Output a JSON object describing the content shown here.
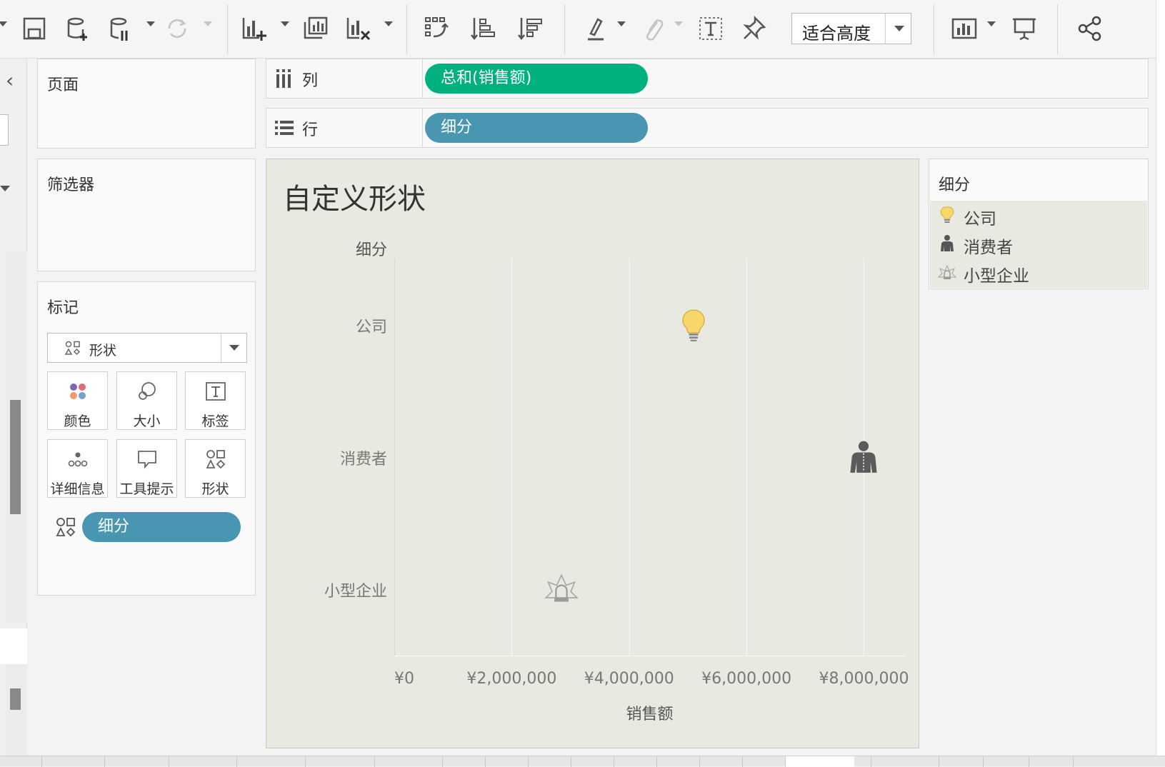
{
  "toolbar": {
    "fit_select_value": "适合高度",
    "icons": [
      "save-icon",
      "new-datasource-icon",
      "pause-update-icon",
      "refresh-icon",
      "new-worksheet-icon",
      "duplicate-sheet-icon",
      "clear-sheet-icon",
      "swap-icon",
      "sort-ascending-icon",
      "sort-descending-icon",
      "highlight-icon",
      "attach-icon",
      "text-label-icon",
      "pin-icon",
      "show-me-icon",
      "presentation-icon",
      "share-icon"
    ]
  },
  "pages_panel": {
    "title": "页面"
  },
  "filters_panel": {
    "title": "筛选器"
  },
  "marks_panel": {
    "title": "标记",
    "mark_type": "形状",
    "buttons": [
      {
        "label": "颜色",
        "icon": "color-icon"
      },
      {
        "label": "大小",
        "icon": "size-icon"
      },
      {
        "label": "标签",
        "icon": "label-icon"
      },
      {
        "label": "详细信息",
        "icon": "detail-icon"
      },
      {
        "label": "工具提示",
        "icon": "tooltip-icon"
      },
      {
        "label": "形状",
        "icon": "shape-icon"
      }
    ],
    "shape_field": "细分"
  },
  "shelves": {
    "columns": {
      "label": "列",
      "pill": "总和(销售额)",
      "pill_color": "#00b180"
    },
    "rows": {
      "label": "行",
      "pill": "细分",
      "pill_color": "#4996b2"
    }
  },
  "legend": {
    "title": "细分",
    "items": [
      {
        "label": "公司",
        "icon": "lightbulb-icon"
      },
      {
        "label": "消费者",
        "icon": "person-icon"
      },
      {
        "label": "小型企业",
        "icon": "bell-icon"
      }
    ]
  },
  "chart_data": {
    "type": "scatter",
    "title": "自定义形状",
    "row_header": "细分",
    "categories": [
      "公司",
      "消费者",
      "小型企业"
    ],
    "values": [
      5100000,
      8000000,
      2850000
    ],
    "shapes": [
      "lightbulb",
      "person",
      "bell"
    ],
    "xlabel": "销售额",
    "xlim": [
      0,
      8700000
    ],
    "x_ticks": [
      0,
      2000000,
      4000000,
      6000000,
      8000000
    ],
    "x_tick_labels": [
      "¥0",
      "¥2,000,000",
      "¥4,000,000",
      "¥6,000,000",
      "¥8,000,000"
    ],
    "grid": true,
    "background": "#e8e9e0"
  }
}
